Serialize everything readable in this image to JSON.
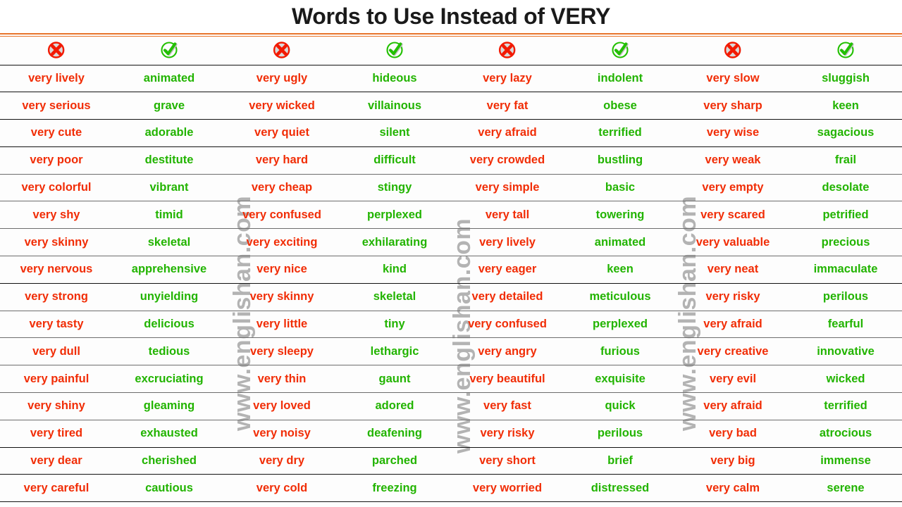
{
  "title": "Words to Use Instead of VERY",
  "colors": {
    "very_red": "#F12D06",
    "synonym_green": "#22B400",
    "rule_orange": "#E8742C",
    "watermark_gray": "#b3b3b3",
    "title_black": "#1a1a1a"
  },
  "header_icons": [
    {
      "name": "cross-icon",
      "glyph": "✖",
      "label": "cross"
    },
    {
      "name": "check-icon",
      "glyph": "✔",
      "label": "check"
    },
    {
      "name": "cross-icon",
      "glyph": "✖",
      "label": "cross"
    },
    {
      "name": "check-icon",
      "glyph": "✔",
      "label": "check"
    },
    {
      "name": "cross-icon",
      "glyph": "✖",
      "label": "cross"
    },
    {
      "name": "check-icon",
      "glyph": "✔",
      "label": "check"
    },
    {
      "name": "cross-icon",
      "glyph": "✖",
      "label": "cross"
    },
    {
      "name": "check-icon",
      "glyph": "✔",
      "label": "check"
    }
  ],
  "watermarks": [
    "www.englishan.com",
    "www.englishan.com",
    "www.englishan.com"
  ],
  "rows": [
    [
      "very lively",
      "animated",
      "very ugly",
      "hideous",
      "very lazy",
      "indolent",
      "very slow",
      "sluggish"
    ],
    [
      "very serious",
      "grave",
      "very wicked",
      "villainous",
      "very fat",
      "obese",
      "very sharp",
      "keen"
    ],
    [
      "very cute",
      "adorable",
      "very quiet",
      "silent",
      "very afraid",
      "terrified",
      "very wise",
      "sagacious"
    ],
    [
      "very poor",
      "destitute",
      "very hard",
      "difficult",
      "very crowded",
      "bustling",
      "very weak",
      "frail"
    ],
    [
      "very colorful",
      "vibrant",
      "very cheap",
      "stingy",
      "very simple",
      "basic",
      "very empty",
      "desolate"
    ],
    [
      "very shy",
      "timid",
      "very confused",
      "perplexed",
      "very tall",
      "towering",
      "very scared",
      "petrified"
    ],
    [
      "very skinny",
      "skeletal",
      "very exciting",
      "exhilarating",
      "very lively",
      "animated",
      "very valuable",
      "precious"
    ],
    [
      "very nervous",
      "apprehensive",
      "very nice",
      "kind",
      "very eager",
      "keen",
      "very neat",
      "immaculate"
    ],
    [
      "very strong",
      "unyielding",
      "very skinny",
      "skeletal",
      "very detailed",
      "meticulous",
      "very risky",
      "perilous"
    ],
    [
      "very tasty",
      "delicious",
      "very little",
      "tiny",
      "very confused",
      "perplexed",
      "very afraid",
      "fearful"
    ],
    [
      "very dull",
      "tedious",
      "very sleepy",
      "lethargic",
      "very angry",
      "furious",
      "very creative",
      "innovative"
    ],
    [
      "very painful",
      "excruciating",
      "very thin",
      "gaunt",
      "very beautiful",
      "exquisite",
      "very evil",
      "wicked"
    ],
    [
      "very shiny",
      "gleaming",
      "very loved",
      "adored",
      "very fast",
      "quick",
      "very afraid",
      "terrified"
    ],
    [
      "very tired",
      "exhausted",
      "very noisy",
      "deafening",
      "very risky",
      "perilous",
      "very bad",
      "atrocious"
    ],
    [
      "very dear",
      "cherished",
      "very dry",
      "parched",
      "very short",
      "brief",
      "very big",
      "immense"
    ],
    [
      "very careful",
      "cautious",
      "very cold",
      "freezing",
      "very worried",
      "distressed",
      "very calm",
      "serene"
    ]
  ]
}
